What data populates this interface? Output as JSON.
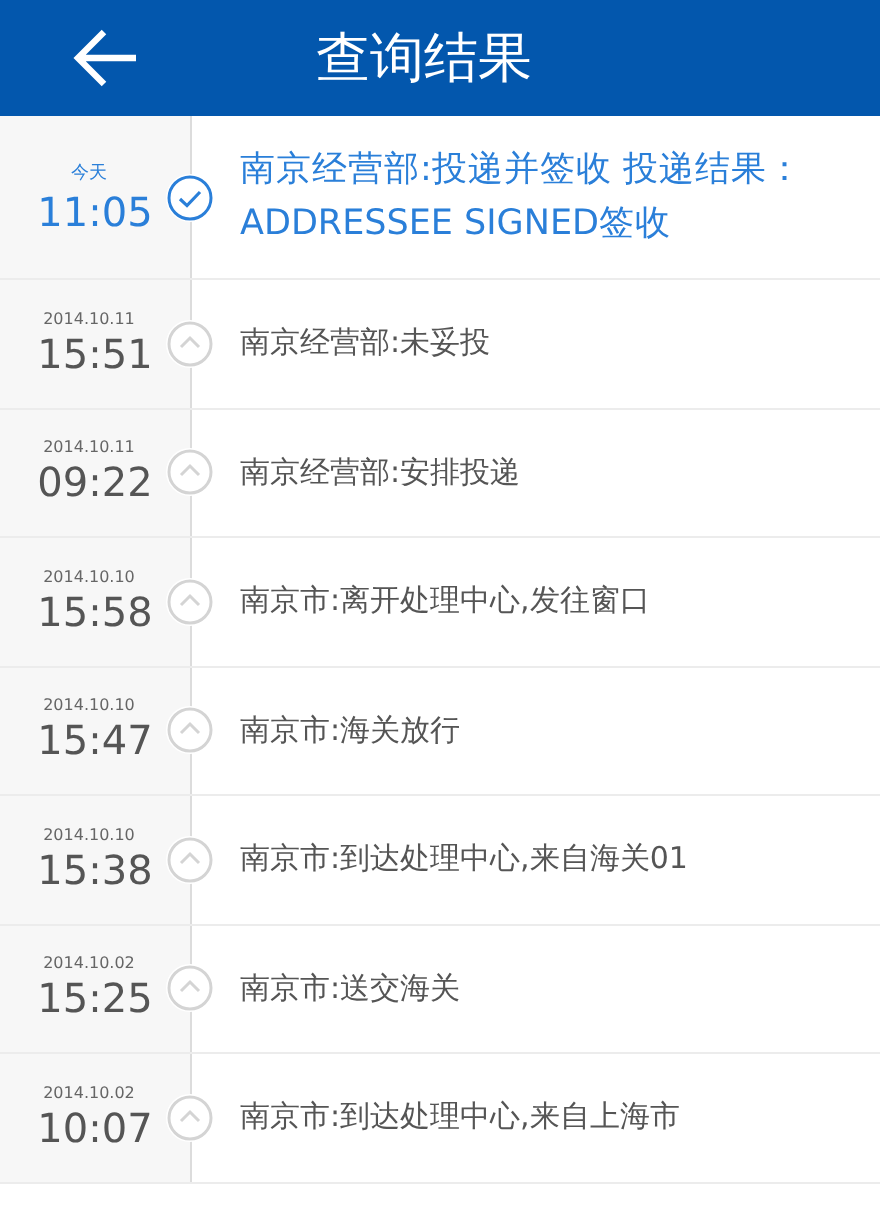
{
  "header": {
    "title": "查询结果"
  },
  "events": [
    {
      "date": "今天",
      "time": "11:05",
      "text": "南京经营部:投递并签收 投递结果：ADDRESSEE SIGNED签收",
      "current": true
    },
    {
      "date": "2014.10.11",
      "time": "15:51",
      "text": "南京经营部:未妥投",
      "current": false
    },
    {
      "date": "2014.10.11",
      "time": "09:22",
      "text": "南京经营部:安排投递",
      "current": false
    },
    {
      "date": "2014.10.10",
      "time": "15:58",
      "text": "南京市:离开处理中心,发往窗口",
      "current": false
    },
    {
      "date": "2014.10.10",
      "time": "15:47",
      "text": "南京市:海关放行",
      "current": false
    },
    {
      "date": "2014.10.10",
      "time": "15:38",
      "text": "南京市:到达处理中心,来自海关01",
      "current": false
    },
    {
      "date": "2014.10.02",
      "time": "15:25",
      "text": "南京市:送交海关",
      "current": false
    },
    {
      "date": "2014.10.02",
      "time": "10:07",
      "text": "南京市:到达处理中心,来自上海市",
      "current": false
    }
  ]
}
